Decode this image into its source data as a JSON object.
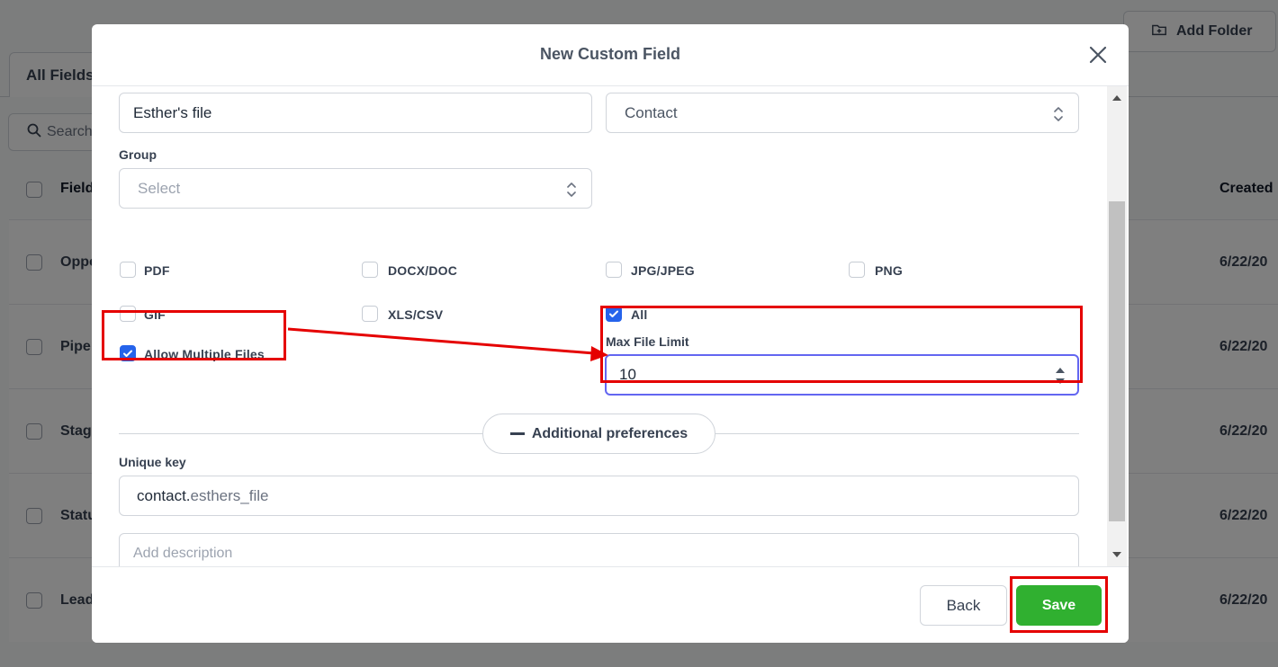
{
  "background": {
    "tab_label": "All Fields",
    "add_folder_label": "Add Folder",
    "search_placeholder": "Search",
    "column_field": "Field",
    "column_created": "Created",
    "rows": [
      {
        "name": "Oppo",
        "date": "6/22/20"
      },
      {
        "name": "Pipe",
        "date": "6/22/20"
      },
      {
        "name": "Stag",
        "date": "6/22/20"
      },
      {
        "name": "Statu",
        "date": "6/22/20"
      },
      {
        "name": "Lead",
        "date": "6/22/20"
      }
    ]
  },
  "modal": {
    "title": "New Custom Field",
    "field_name_value": "Esther's file",
    "object_value": "Contact",
    "group_label": "Group",
    "group_placeholder": "Select",
    "file_types": [
      {
        "label": "PDF",
        "checked": false
      },
      {
        "label": "DOCX/DOC",
        "checked": false
      },
      {
        "label": "JPG/JPEG",
        "checked": false
      },
      {
        "label": "PNG",
        "checked": false
      },
      {
        "label": "GIF",
        "checked": false
      },
      {
        "label": "XLS/CSV",
        "checked": false
      },
      {
        "label": "All",
        "checked": true
      }
    ],
    "allow_multiple_label": "Allow Multiple Files",
    "allow_multiple_checked": true,
    "max_file_limit_label": "Max File Limit",
    "max_file_limit_value": "10",
    "additional_preferences_label": "Additional preferences",
    "unique_key_label": "Unique key",
    "unique_key_prefix": "contact.",
    "unique_key_value": "esthers_file",
    "description_placeholder": "Add description",
    "back_label": "Back",
    "save_label": "Save"
  },
  "colors": {
    "save_button": "#30b030",
    "checkbox_checked": "#2563eb",
    "annotation": "#e50000",
    "focus_border": "#6366f1"
  }
}
